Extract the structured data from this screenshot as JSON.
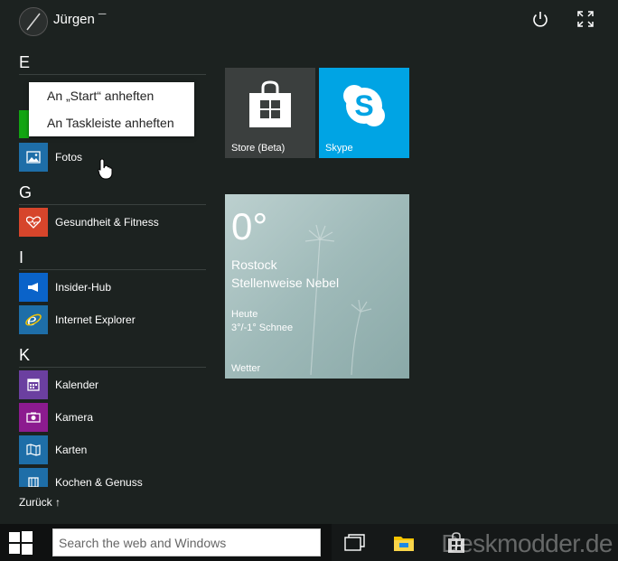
{
  "user": {
    "name": "Jürgen ¯"
  },
  "header": {
    "power_icon": "power-icon",
    "expand_icon": "expand-icon"
  },
  "app_list": {
    "groups": [
      {
        "letter": "E"
      },
      {
        "letter": "G"
      },
      {
        "letter": "I"
      },
      {
        "letter": "K"
      }
    ],
    "apps": {
      "fotos": {
        "label": "Fotos",
        "color": "#1e6ea8"
      },
      "gesundheit": {
        "label": "Gesundheit & Fitness",
        "color": "#d6452b"
      },
      "insider": {
        "label": "Insider-Hub",
        "color": "#0a63c9"
      },
      "ie": {
        "label": "Internet Explorer",
        "color": "#1e6ea8"
      },
      "kalender": {
        "label": "Kalender",
        "color": "#6b3fa0"
      },
      "kamera": {
        "label": "Kamera",
        "color": "#8c1b8f"
      },
      "karten": {
        "label": "Karten",
        "color": "#1e6ea8"
      },
      "kochen": {
        "label": "Kochen & Genuss",
        "color": "#1e6ea8"
      }
    },
    "back_label": "Zurück ↑"
  },
  "context_menu": {
    "items": [
      "An „Start“ anheften",
      "An Taskleiste anheften"
    ]
  },
  "tiles": {
    "store": {
      "label": "Store (Beta)",
      "color": "#3b3f3e"
    },
    "skype": {
      "label": "Skype",
      "color": "#00a4e4"
    },
    "weather": {
      "temp": "0°",
      "city": "Rostock",
      "condition": "Stellenweise Nebel",
      "day": "Heute",
      "forecast": "3°/-1° Schnee",
      "label": "Wetter"
    }
  },
  "taskbar": {
    "search_placeholder": "Search the web and Windows"
  },
  "watermark": "Deskmodder.de"
}
